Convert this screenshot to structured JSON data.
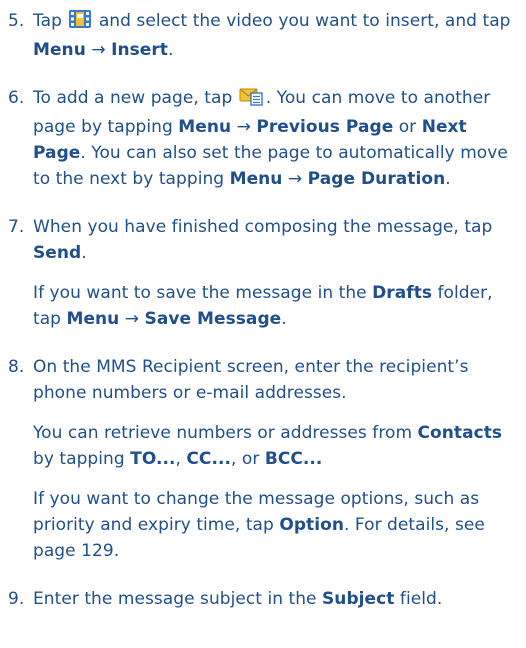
{
  "steps": [
    {
      "number": "5.",
      "p1": {
        "t1": "Tap ",
        "icon": "video-clip-icon",
        "t2": " and select the video you want to insert, and tap ",
        "b1": "Menu",
        "arrow": " → ",
        "b2": "Insert",
        "t3": "."
      }
    },
    {
      "number": "6.",
      "p1": {
        "t1": "To add a new page, tap ",
        "icon": "new-page-icon",
        "t2": ". You can move to another page by tapping ",
        "b1": "Menu",
        "arrow1": " → ",
        "b2": "Previous Page",
        "t3": " or ",
        "b3": "Next Page",
        "t4": ". You can also set the page to automatically move to the next by tapping ",
        "b4": "Menu",
        "arrow2": " → ",
        "b5": "Page Duration",
        "t5": "."
      }
    },
    {
      "number": "7.",
      "p1": {
        "t1": "When you have finished composing the message, tap ",
        "b1": "Send",
        "t2": "."
      },
      "p2": {
        "t1": "If you want to save the message in the ",
        "b1": "Drafts",
        "t2": " folder, tap ",
        "b2": "Menu",
        "arrow": " → ",
        "b3": "Save Message",
        "t3": "."
      }
    },
    {
      "number": "8.",
      "p1": {
        "t1": "On the MMS Recipient screen, enter the recipient’s phone numbers or e-mail addresses."
      },
      "p2": {
        "t1": "You can retrieve numbers or addresses from ",
        "b1": "Contacts",
        "t2": " by tapping ",
        "b2": "TO...",
        "t3": ", ",
        "b3": "CC...",
        "t4": ", or ",
        "b4": "BCC..."
      },
      "p3": {
        "t1": "If you want to change the message options, such as priority and expiry time, tap ",
        "b1": "Option",
        "t2": ". For details, see page 129."
      }
    },
    {
      "number": "9.",
      "p1": {
        "t1": "Enter the message subject in the ",
        "b1": "Subject",
        "t2": " field."
      }
    }
  ],
  "colors": {
    "text": "#1f4f8c",
    "icon_blue": "#3a78c8",
    "icon_yellow": "#f2c230"
  }
}
